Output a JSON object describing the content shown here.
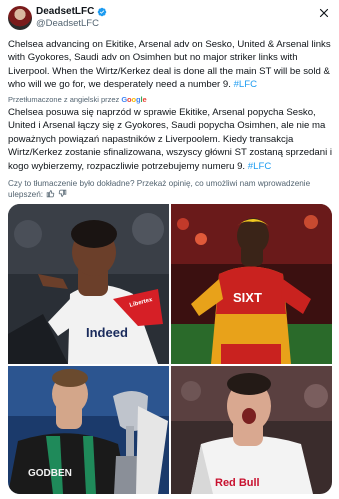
{
  "author": {
    "display_name": "DeadsetLFC",
    "handle": "@DeadsetLFC"
  },
  "tweet": {
    "text": "Chelsea advancing on Ekitike, Arsenal adv on Sesko, United & Arsenal links with Gyokores, Saudi adv on Osimhen but no major striker links with Liverpool. When the Wirtz/Kerkez deal is done all the main ST will be sold & who will we go for, we desperately need a number 9.",
    "hashtag": "#LFC"
  },
  "translation": {
    "label": "Przetłumaczone z angielski przez",
    "provider": [
      "G",
      "o",
      "o",
      "g",
      "l",
      "e"
    ],
    "text": "Chelsea posuwa się naprzód w sprawie Ekitike, Arsenal popycha Sesko, United i Arsenal łączy się z Gyokores, Saudi popycha Osimhen, ale nie ma poważnych powiązań napastników z Liverpoolem. Kiedy transakcja Wirtz/Kerkez zostanie sfinalizowana, wszyscy główni ST zostaną sprzedani i kogo wybierzemy, rozpaczliwie potrzebujemy numeru 9.",
    "hashtag": "#LFC"
  },
  "feedback": {
    "question": "Czy to tłumaczenie było dokładne? Przekaż opinię, co umożliwi nam wprowadzenie ulepszeń:"
  },
  "media": {
    "photo1": {
      "shirt_text": "Indeed",
      "sleeve_text": "Libertex"
    },
    "photo2": {
      "shirt_text": "SIXT"
    },
    "photo3": {
      "shirt_text": "GODBEN"
    },
    "photo4": {
      "shirt_text": "Red Bull"
    }
  },
  "colors": {
    "accent": "#1d9bf0",
    "text": "#0f1419",
    "muted": "#536471"
  },
  "icons": {
    "verified": "verified-badge-icon",
    "close": "close-icon",
    "thumbs_up": "thumbs-up-icon",
    "thumbs_down": "thumbs-down-icon"
  }
}
